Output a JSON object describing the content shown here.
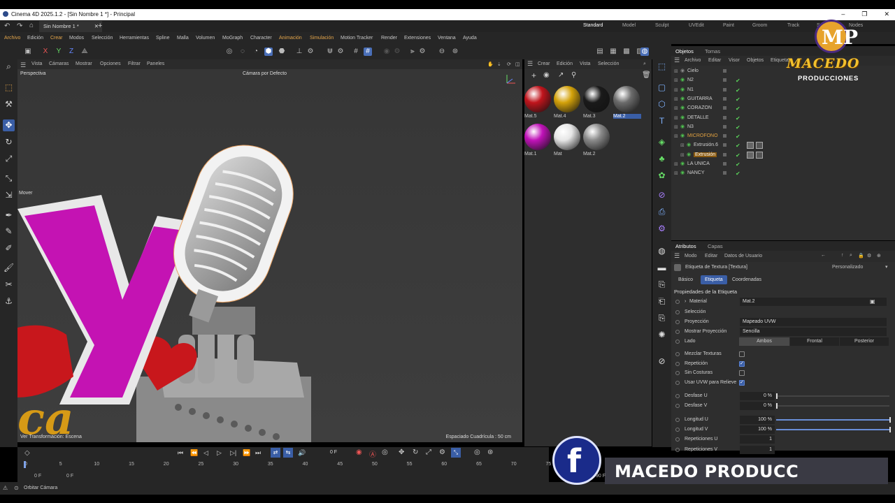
{
  "app": {
    "title": "Cinema 4D 2025.1.2 - [Sin Nombre 1 *] - Principal",
    "doc_tab": "Sin Nombre 1 *"
  },
  "layouts": [
    "Standard",
    "Model",
    "Sculpt",
    "UVEdit",
    "Paint",
    "Groom",
    "Track",
    "Script",
    "Nodes"
  ],
  "menu": [
    {
      "label": "Archivo",
      "accent": true
    },
    {
      "label": "Edición",
      "accent": false
    },
    {
      "label": "Crear",
      "accent": true
    },
    {
      "label": "Modos",
      "accent": false
    },
    {
      "label": "Selección",
      "accent": false
    },
    {
      "label": "Herramientas",
      "accent": false
    },
    {
      "label": "Spline",
      "accent": false
    },
    {
      "label": "Malla",
      "accent": false
    },
    {
      "label": "Volumen",
      "accent": false
    },
    {
      "label": "MoGraph",
      "accent": false
    },
    {
      "label": "Character",
      "accent": false
    },
    {
      "label": "Animación",
      "accent": true
    },
    {
      "label": "Simulación",
      "accent": true
    },
    {
      "label": "Motion Tracker",
      "accent": false
    },
    {
      "label": "Render",
      "accent": false
    },
    {
      "label": "Extensiones",
      "accent": false
    },
    {
      "label": "Ventana",
      "accent": false
    },
    {
      "label": "Ayuda",
      "accent": false
    }
  ],
  "viewport": {
    "menu": [
      "Vista",
      "Cámaras",
      "Mostrar",
      "Opciones",
      "Filtrar",
      "Paneles"
    ],
    "label": "Perspectiva",
    "camera": "Cámara por Defecto",
    "mover": "Mover",
    "grid_spacing": "Espaciado Cuadrícula : 50 cm",
    "transform": "Ver Transformación: Escena"
  },
  "material_panel": {
    "menu": [
      "Crear",
      "Edición",
      "Vista",
      "Selección"
    ],
    "materials": [
      {
        "name": "Mat.5",
        "color": "#c0141c",
        "selected": false
      },
      {
        "name": "Mat.4",
        "color": "#d4a20a",
        "selected": false
      },
      {
        "name": "Mat.3",
        "color": "#1a1a1a",
        "selected": false
      },
      {
        "name": "Mat.2",
        "color": "#6c6c6c",
        "selected": true
      },
      {
        "name": "Mat.1",
        "color": "#c012b8",
        "selected": false
      },
      {
        "name": "Mat",
        "color": "#e6e6e6",
        "selected": false
      },
      {
        "name": "Mat.2",
        "color": "#8a8a8a",
        "selected": false
      }
    ]
  },
  "objects_panel": {
    "tabs": [
      "Objetos",
      "Tomas"
    ],
    "menu": [
      "Archivo",
      "Editar",
      "Visor",
      "Objetos",
      "Etiquetas"
    ],
    "items": [
      {
        "name": "Cielo",
        "indent": 0,
        "style": "normal"
      },
      {
        "name": "N2",
        "indent": 0,
        "style": "normal"
      },
      {
        "name": "N1",
        "indent": 0,
        "style": "normal"
      },
      {
        "name": "GUITARRA",
        "indent": 0,
        "style": "normal"
      },
      {
        "name": "CORAZON",
        "indent": 0,
        "style": "normal"
      },
      {
        "name": "DETALLE",
        "indent": 0,
        "style": "normal"
      },
      {
        "name": "N3",
        "indent": 0,
        "style": "normal"
      },
      {
        "name": "MICROFONO",
        "indent": 0,
        "style": "hl"
      },
      {
        "name": "Extrusión.6",
        "indent": 1,
        "style": "normal"
      },
      {
        "name": "Extrusión",
        "indent": 1,
        "style": "hl2"
      },
      {
        "name": "LA UNICA",
        "indent": 0,
        "style": "normal"
      },
      {
        "name": "NANCY",
        "indent": 0,
        "style": "normal"
      }
    ]
  },
  "attributes_panel": {
    "tabs": [
      "Atributos",
      "Capas"
    ],
    "menu": [
      "Modo",
      "Editar",
      "Datos de Usuario"
    ],
    "header": "Etiqueta de Textura [Textura]",
    "preset": "Personalizado",
    "subtabs": [
      "Básico",
      "Etiqueta",
      "Coordenadas"
    ],
    "active_subtab": "Etiqueta",
    "section": "Propiedades de la Etiqueta",
    "material_label": "Material",
    "material_value": "Mat.2",
    "seleccion_label": "Selección",
    "proyeccion_label": "Proyección",
    "proyeccion_value": "Mapeado UVW",
    "mostrar_label": "Mostrar Proyección",
    "mostrar_value": "Sencilla",
    "lado_label": "Lado",
    "lado_options": [
      "Ambos",
      "Frontal",
      "Posterior"
    ],
    "checkboxes": [
      {
        "label": "Mezclar Texturas",
        "checked": false
      },
      {
        "label": "Repetición",
        "checked": true
      },
      {
        "label": "Sin Costuras",
        "checked": false
      },
      {
        "label": "Usar UVW para Relieve",
        "checked": true
      }
    ],
    "numeric": [
      {
        "label": "Desfase U",
        "value": "0 %",
        "fill": 0.0
      },
      {
        "label": "Desfase V",
        "value": "0 %",
        "fill": 0.0
      },
      {
        "label": "Longitud U",
        "value": "100 %",
        "fill": 1.0
      },
      {
        "label": "Longitud V",
        "value": "100 %",
        "fill": 1.0
      },
      {
        "label": "Repeticiones U",
        "value": "1",
        "fill": null
      },
      {
        "label": "Repeticiones V",
        "value": "1",
        "fill": null
      }
    ]
  },
  "timeline": {
    "current_frame": "0 F",
    "ticks": [
      "0",
      "5",
      "10",
      "15",
      "20",
      "25",
      "30",
      "35",
      "40",
      "45",
      "50",
      "55",
      "60",
      "65",
      "70",
      "75"
    ],
    "start": "0 F",
    "start2": "0 F",
    "end": "90 F"
  },
  "status": "Orbitar Cámara",
  "branding": {
    "logo_text": "MACEDO",
    "logo_sub": "PRODUCCIONES",
    "banner": "MACEDO PRODUCC"
  }
}
